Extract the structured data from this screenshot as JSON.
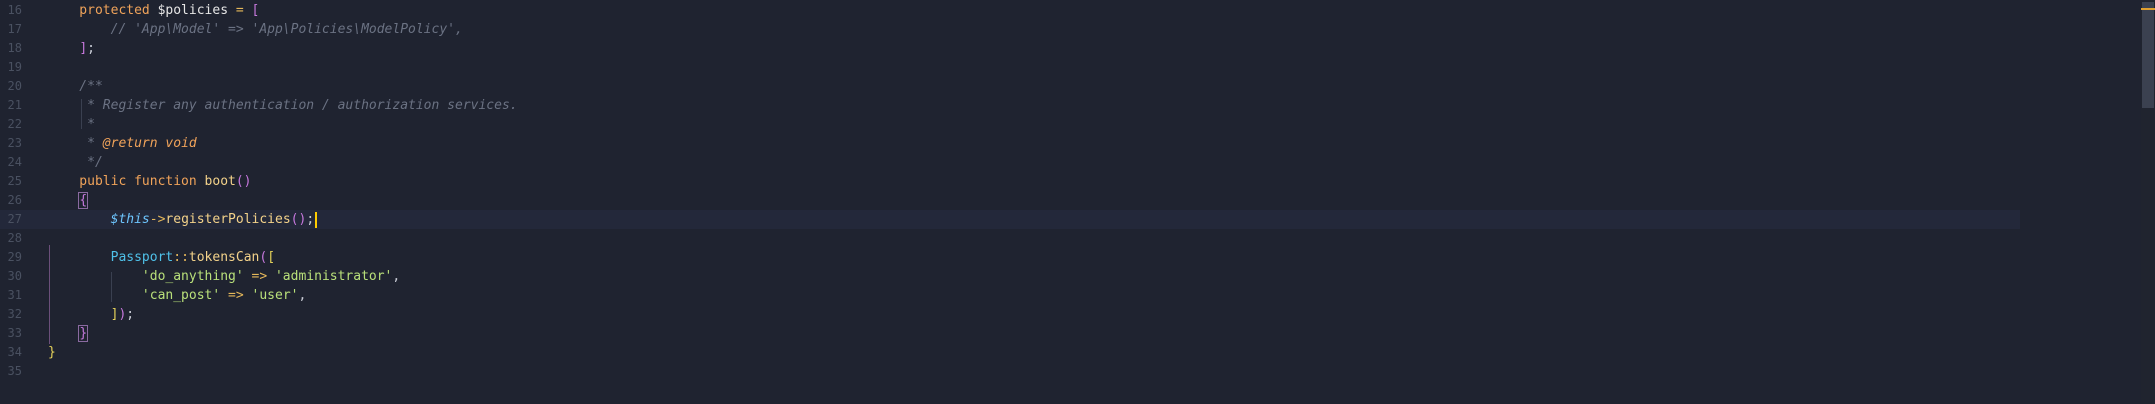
{
  "editor": {
    "lines": [
      {
        "n": "16",
        "tokens": [
          {
            "t": "    protected ",
            "c": "kw"
          },
          {
            "t": "$policies",
            "c": "var"
          },
          {
            "t": " = ",
            "c": "op"
          },
          {
            "t": "[",
            "c": "br-p"
          }
        ]
      },
      {
        "n": "17",
        "tokens": [
          {
            "t": "        // 'App\\Model' => 'App\\Policies\\ModelPolicy',",
            "c": "cm"
          }
        ]
      },
      {
        "n": "18",
        "tokens": [
          {
            "t": "    ",
            "c": "punc"
          },
          {
            "t": "]",
            "c": "br-p"
          },
          {
            "t": ";",
            "c": "punc"
          }
        ]
      },
      {
        "n": "19",
        "tokens": []
      },
      {
        "n": "20",
        "tokens": [
          {
            "t": "    /**",
            "c": "cm"
          }
        ]
      },
      {
        "n": "21",
        "tokens": [
          {
            "t": "     * Register any authentication / authorization services.",
            "c": "cm"
          }
        ]
      },
      {
        "n": "22",
        "tokens": [
          {
            "t": "     *",
            "c": "cm"
          }
        ]
      },
      {
        "n": "23",
        "tokens": [
          {
            "t": "     * ",
            "c": "cm"
          },
          {
            "t": "@return void",
            "c": "cm-tag"
          }
        ]
      },
      {
        "n": "24",
        "tokens": [
          {
            "t": "     */",
            "c": "cm"
          }
        ]
      },
      {
        "n": "25",
        "tokens": [
          {
            "t": "    public function ",
            "c": "kw"
          },
          {
            "t": "boot",
            "c": "fn"
          },
          {
            "t": "()",
            "c": "br-p"
          }
        ]
      },
      {
        "n": "26",
        "tokens": [
          {
            "t": "    ",
            "c": "punc"
          },
          {
            "t": "{",
            "c": "br-p",
            "match": true
          }
        ]
      },
      {
        "n": "27",
        "tokens": [
          {
            "t": "        ",
            "c": "punc"
          },
          {
            "t": "$this",
            "c": "this"
          },
          {
            "t": "->",
            "c": "op"
          },
          {
            "t": "registerPolicies",
            "c": "fn"
          },
          {
            "t": "()",
            "c": "br-p"
          },
          {
            "t": ";",
            "c": "punc"
          }
        ],
        "active": true,
        "cursor": true
      },
      {
        "n": "28",
        "tokens": []
      },
      {
        "n": "29",
        "tokens": [
          {
            "t": "        ",
            "c": "punc"
          },
          {
            "t": "Passport",
            "c": "cls"
          },
          {
            "t": "::",
            "c": "op"
          },
          {
            "t": "tokensCan",
            "c": "fn"
          },
          {
            "t": "(",
            "c": "br-p"
          },
          {
            "t": "[",
            "c": "br-y"
          }
        ]
      },
      {
        "n": "30",
        "tokens": [
          {
            "t": "            ",
            "c": "punc"
          },
          {
            "t": "'do_anything'",
            "c": "str"
          },
          {
            "t": " => ",
            "c": "op"
          },
          {
            "t": "'administrator'",
            "c": "str"
          },
          {
            "t": ",",
            "c": "punc"
          }
        ]
      },
      {
        "n": "31",
        "tokens": [
          {
            "t": "            ",
            "c": "punc"
          },
          {
            "t": "'can_post'",
            "c": "str"
          },
          {
            "t": " => ",
            "c": "op"
          },
          {
            "t": "'user'",
            "c": "str"
          },
          {
            "t": ",",
            "c": "punc"
          }
        ]
      },
      {
        "n": "32",
        "tokens": [
          {
            "t": "        ",
            "c": "punc"
          },
          {
            "t": "]",
            "c": "br-y"
          },
          {
            "t": ")",
            "c": "br-p"
          },
          {
            "t": ";",
            "c": "punc"
          }
        ]
      },
      {
        "n": "33",
        "tokens": [
          {
            "t": "    ",
            "c": "punc"
          },
          {
            "t": "}",
            "c": "br-p",
            "match": true
          }
        ]
      },
      {
        "n": "34",
        "tokens": [
          {
            "t": "}",
            "c": "br-y"
          }
        ]
      },
      {
        "n": "35",
        "tokens": []
      }
    ]
  },
  "colors": {
    "background": "#1f2330",
    "active_line": "#23283a",
    "cursor": "#ffcc00"
  }
}
